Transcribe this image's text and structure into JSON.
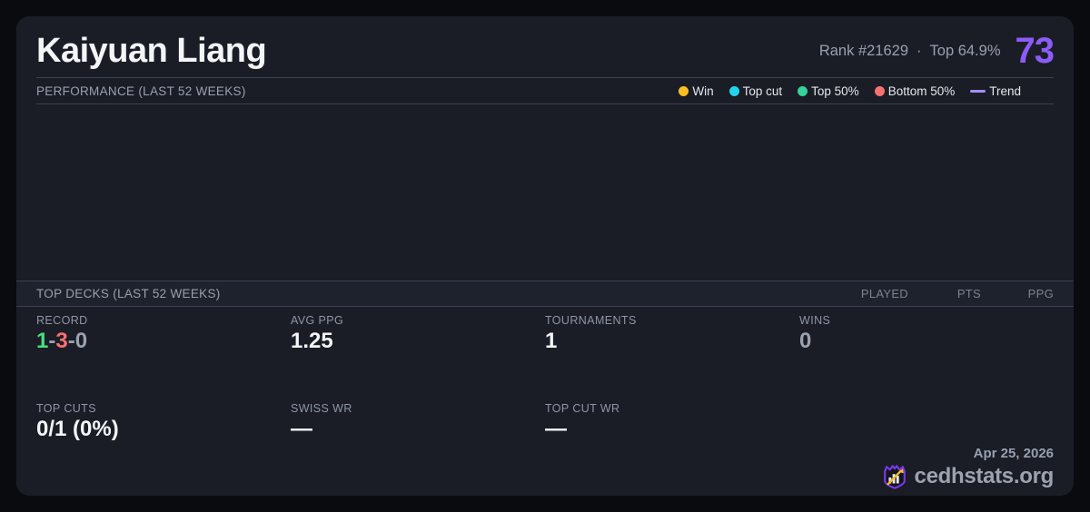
{
  "header": {
    "player_name": "Kaiyuan Liang",
    "rank": "Rank #21629",
    "separator": "·",
    "top_percent": "Top 64.9%",
    "score": "73"
  },
  "performance": {
    "title": "PERFORMANCE (LAST 52 WEEKS)",
    "legend": [
      {
        "name": "win",
        "label": "Win",
        "color": "#fbbf24",
        "type": "dot"
      },
      {
        "name": "top-cut",
        "label": "Top cut",
        "color": "#22d3ee",
        "type": "dot"
      },
      {
        "name": "top-50",
        "label": "Top 50%",
        "color": "#34d399",
        "type": "dot"
      },
      {
        "name": "bottom-50",
        "label": "Bottom 50%",
        "color": "#f87171",
        "type": "dot"
      },
      {
        "name": "trend",
        "label": "Trend",
        "color": "#a78bfa",
        "type": "line"
      }
    ],
    "chart_empty": true
  },
  "top_decks": {
    "title": "TOP DECKS (LAST 52 WEEKS)",
    "columns": [
      "PLAYED",
      "PTS",
      "PPG"
    ],
    "rows": []
  },
  "stats": {
    "record": {
      "label": "RECORD",
      "win": "1",
      "loss": "3",
      "draw": "0",
      "sep": "-"
    },
    "avg_ppg": {
      "label": "AVG PPG",
      "value": "1.25"
    },
    "tournaments": {
      "label": "TOURNAMENTS",
      "value": "1"
    },
    "wins": {
      "label": "WINS",
      "value": "0"
    },
    "top_cuts": {
      "label": "TOP CUTS",
      "value": "0/1 (0%)"
    },
    "swiss_wr": {
      "label": "SWISS WR",
      "value": "—"
    },
    "top_cut_wr": {
      "label": "TOP CUT WR",
      "value": "—"
    }
  },
  "footer": {
    "date": "Apr 25, 2026",
    "brand": "cedhstats.org"
  },
  "colors": {
    "background": "#0a0b0e",
    "card": "#1a1d26",
    "divider": "#3a4152",
    "accent_purple": "#8b5cf6",
    "win_green": "#4ade80",
    "loss_red": "#f87171",
    "muted_gray": "#9aa1af",
    "logo_purple": "#7c3aed",
    "logo_gold": "#fbbf24"
  }
}
